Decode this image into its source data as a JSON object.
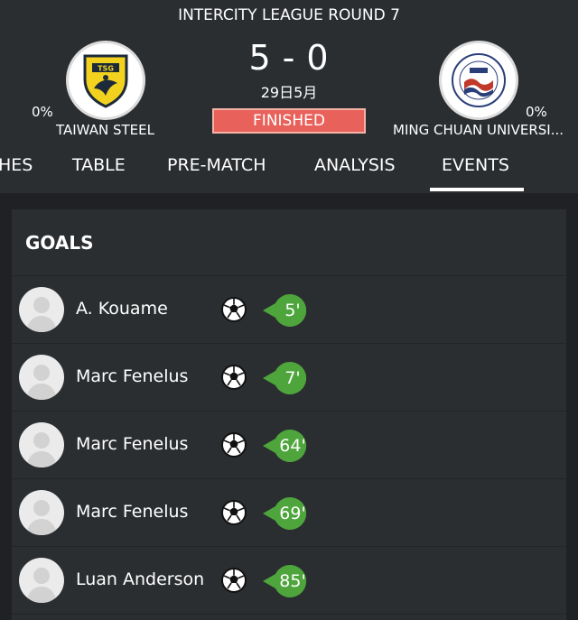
{
  "match": {
    "round_title": "INTERCITY LEAGUE ROUND 7",
    "score_home": "5",
    "score_separator": "-",
    "score_away": "0",
    "date": "29日5月",
    "status": "FINISHED",
    "status_color": "#e8615a"
  },
  "home_team": {
    "name": "TAIWAN STEEL",
    "possession": "0%",
    "logo_text": "TSG"
  },
  "away_team": {
    "name": "MING CHUAN UNIVERSI...",
    "possession": "0%"
  },
  "tabs": [
    {
      "label": "HES",
      "active": false
    },
    {
      "label": "TABLE",
      "active": false
    },
    {
      "label": "PRE-MATCH",
      "active": false
    },
    {
      "label": "ANALYSIS",
      "active": false
    },
    {
      "label": "EVENTS",
      "active": true
    }
  ],
  "goals": {
    "title": "GOALS",
    "accent_color": "#4ea53c",
    "items": [
      {
        "player": "A. Kouame",
        "minute": "5'",
        "icon": "soccer-ball-icon"
      },
      {
        "player": "Marc Fenelus",
        "minute": "7'",
        "icon": "soccer-ball-icon"
      },
      {
        "player": "Marc Fenelus",
        "minute": "64'",
        "icon": "soccer-ball-icon"
      },
      {
        "player": "Marc Fenelus",
        "minute": "69'",
        "icon": "soccer-ball-icon"
      },
      {
        "player": "Luan Anderson",
        "minute": "85'",
        "icon": "soccer-ball-icon"
      }
    ]
  }
}
